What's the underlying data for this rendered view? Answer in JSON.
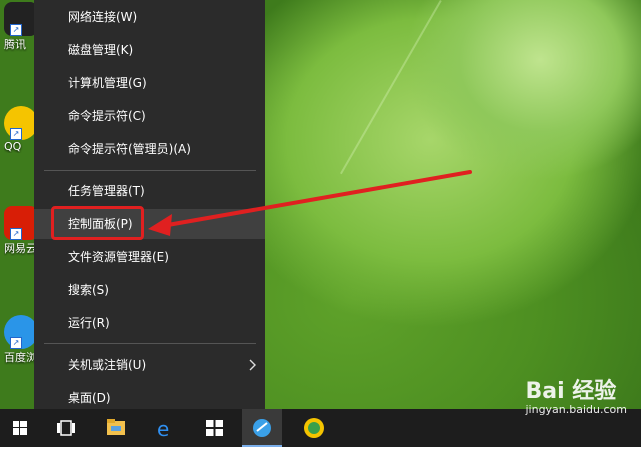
{
  "desktop_icons": [
    {
      "label": "腾讯",
      "color": "#1a1a1a"
    },
    {
      "label": "QQ",
      "color": "#f5c400"
    },
    {
      "label": "网易云",
      "color": "#d81e06"
    },
    {
      "label": "百度浏",
      "color": "#2a95e8"
    }
  ],
  "context_menu": {
    "items": [
      {
        "label": "网络连接(W)"
      },
      {
        "label": "磁盘管理(K)"
      },
      {
        "label": "计算机管理(G)"
      },
      {
        "label": "命令提示符(C)"
      },
      {
        "label": "命令提示符(管理员)(A)"
      },
      {
        "label": "任务管理器(T)"
      },
      {
        "label": "控制面板(P)",
        "highlighted": true
      },
      {
        "label": "文件资源管理器(E)"
      },
      {
        "label": "搜索(S)"
      },
      {
        "label": "运行(R)"
      },
      {
        "label": "关机或注销(U)",
        "submenu": true
      },
      {
        "label": "桌面(D)"
      }
    ],
    "submenu_chevron": "chevron-right-icon"
  },
  "annotation": {
    "color": "#e02020"
  },
  "taskbar": {
    "icons": [
      "windows-start-icon",
      "task-view-icon",
      "file-explorer-icon",
      "edge-icon",
      "store-icon",
      "app-icon",
      "qq-browser-icon"
    ]
  },
  "watermark": {
    "brand": "Bai 经验",
    "sub": "jingyan.baidu.com"
  }
}
